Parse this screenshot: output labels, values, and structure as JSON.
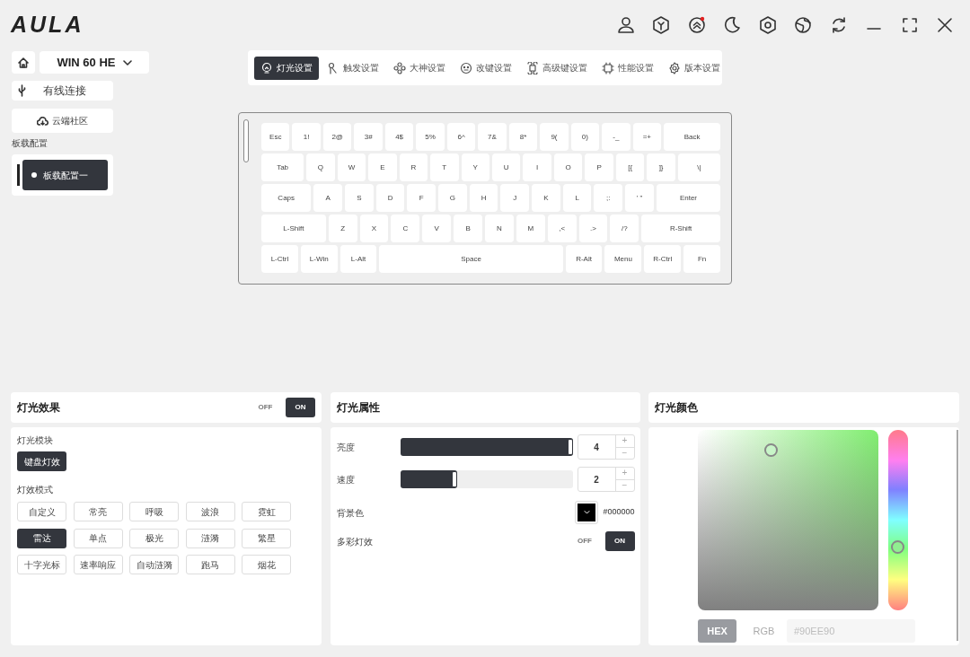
{
  "app": {
    "logo": "AULA"
  },
  "device": {
    "name": "WIN 60 HE"
  },
  "sidebar": {
    "connection": "有线连接",
    "cloud": "云端社区",
    "section_label": "板载配置",
    "profiles": [
      {
        "label": "板载配置一",
        "selected": true
      }
    ]
  },
  "tabs": [
    {
      "label": "灯光设置",
      "selected": true
    },
    {
      "label": "触发设置",
      "selected": false
    },
    {
      "label": "大神设置",
      "selected": false
    },
    {
      "label": "改键设置",
      "selected": false
    },
    {
      "label": "高级键设置",
      "selected": false
    },
    {
      "label": "性能设置",
      "selected": false
    },
    {
      "label": "版本设置",
      "selected": false
    }
  ],
  "keyboard": {
    "rows": [
      [
        "Esc",
        "1!",
        "2@",
        "3#",
        "4$",
        "5%",
        "6^",
        "7&",
        "8*",
        "9(",
        "0)",
        "-_",
        "=+",
        "Back"
      ],
      [
        "Tab",
        "Q",
        "W",
        "E",
        "R",
        "T",
        "Y",
        "U",
        "I",
        "O",
        "P",
        "[{",
        "]}",
        "\\|"
      ],
      [
        "Caps",
        "A",
        "S",
        "D",
        "F",
        "G",
        "H",
        "J",
        "K",
        "L",
        ";:",
        "' \"",
        "Enter"
      ],
      [
        "L-Shift",
        "Z",
        "X",
        "C",
        "V",
        "B",
        "N",
        "M",
        ",<",
        ".>",
        "/?",
        "R-Shift"
      ],
      [
        "L-Ctrl",
        "L-Win",
        "L-Alt",
        "Space",
        "R-Alt",
        "Menu",
        "R-Ctrl",
        "Fn"
      ]
    ]
  },
  "effects_panel": {
    "title": "灯光效果",
    "toggle": [
      {
        "label": "OFF",
        "selected": false
      },
      {
        "label": "ON",
        "selected": true
      }
    ],
    "module_label": "灯光模块",
    "modules": [
      {
        "label": "键盘灯效",
        "selected": true
      }
    ],
    "mode_label": "灯效模式",
    "modes": [
      {
        "label": "自定义",
        "selected": false
      },
      {
        "label": "常亮",
        "selected": false
      },
      {
        "label": "呼吸",
        "selected": false
      },
      {
        "label": "波浪",
        "selected": false
      },
      {
        "label": "霓虹",
        "selected": false
      },
      {
        "label": "雷达",
        "selected": true
      },
      {
        "label": "单点",
        "selected": false
      },
      {
        "label": "极光",
        "selected": false
      },
      {
        "label": "涟漪",
        "selected": false
      },
      {
        "label": "繁星",
        "selected": false
      },
      {
        "label": "十字光标",
        "selected": false
      },
      {
        "label": "速率响应",
        "selected": false
      },
      {
        "label": "自动涟漪",
        "selected": false
      },
      {
        "label": "跑马",
        "selected": false
      },
      {
        "label": "烟花",
        "selected": false
      }
    ]
  },
  "properties_panel": {
    "title": "灯光属性",
    "sliders": [
      {
        "label": "亮度",
        "level": 1.0,
        "value": "4",
        "plus": "+",
        "minus": "−"
      },
      {
        "label": "速度",
        "level": 0.33,
        "value": "2",
        "plus": "+",
        "minus": "−"
      }
    ],
    "background": {
      "label": "背景色",
      "color": "#000000",
      "value": "#000000"
    },
    "multicolor": {
      "label": "多彩灯效",
      "toggle": [
        {
          "label": "OFF",
          "selected": false
        },
        {
          "label": "ON",
          "selected": true
        }
      ]
    }
  },
  "color_panel": {
    "title": "灯光颜色",
    "modes": [
      {
        "label": "HEX",
        "selected": true
      },
      {
        "label": "RGB",
        "selected": false
      }
    ],
    "placeholder": "#90EE90"
  }
}
